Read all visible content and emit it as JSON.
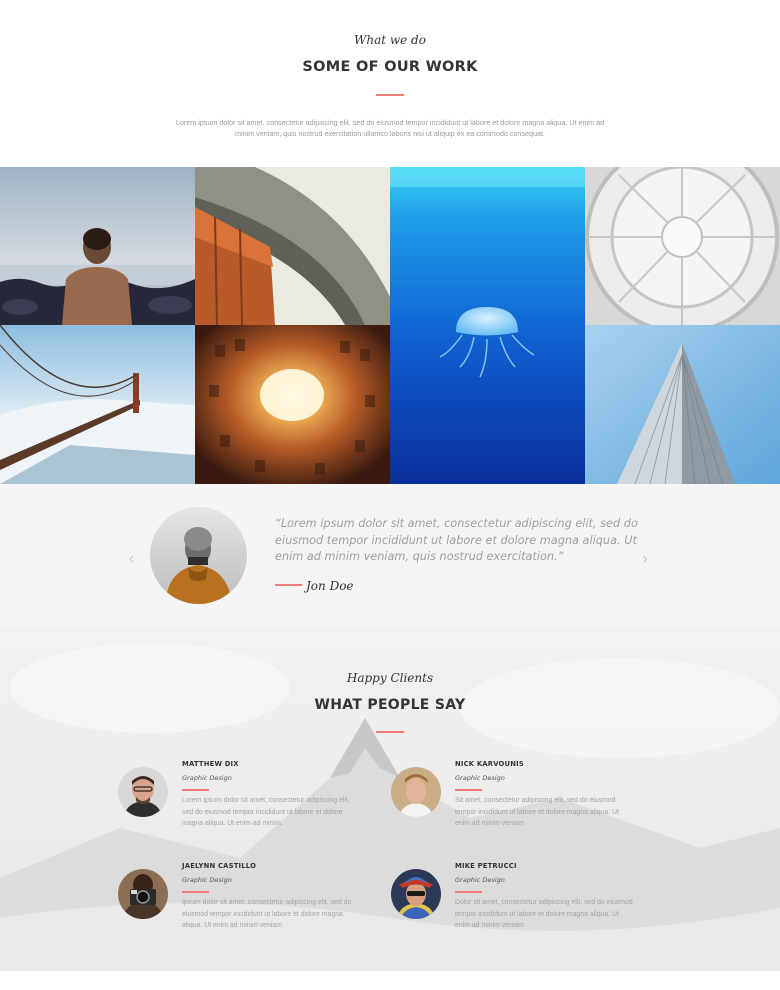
{
  "work": {
    "subtitle": "What we do",
    "title": "SOME OF OUR WORK",
    "description": "Lorem ipsum dolor sit amet, consectetur adipiscing elit, sed do eiusmod tempor incididunt ut labore et dolore magna aliqua. Ut enim ad minim veniam, quis nostrud exercitation ullamco laboris nisi ut aliquip ex ea commodo consequat."
  },
  "gallery": {
    "items": [
      {
        "name": "man-on-beach"
      },
      {
        "name": "bridge-underside"
      },
      {
        "name": "jellyfish"
      },
      {
        "name": "glass-dome"
      },
      {
        "name": "golden-gate-fog"
      },
      {
        "name": "courtyard-looking-up"
      },
      {
        "name": "skyscraper"
      }
    ]
  },
  "testimonial": {
    "quote": "“Lorem ipsum dolor sit amet, consectetur adipiscing elit, sed do eiusmod tempor incididunt ut labore et dolore magna aliqua. Ut enim ad minim veniam, quis nostrud exercitation.”",
    "author": "Jon Doe",
    "prev_icon": "‹",
    "next_icon": "›"
  },
  "clients": {
    "subtitle": "Happy Clients",
    "title": "WHAT PEOPLE SAY",
    "people": [
      {
        "name": "MATTHEW DIX",
        "role": "Graphic Design",
        "text": "Lorem ipsum dolor sit amet, consectetur adipiscing elit, sed do eiusmod tempor incididunt ut labore et dolore magna aliqua. Ut enim ad minim."
      },
      {
        "name": "NICK KARVOUNIS",
        "role": "Graphic Design",
        "text": "Sit amet, consectetur adipiscing elit, sed do eiusmod tempor incididunt ut labore et dolore magna aliqua. Ut enim ad minim veniam"
      },
      {
        "name": "JAELYNN CASTILLO",
        "role": "Graphic Design",
        "text": "Ipsum dolor sit amet, consectetur adipiscing elit, sed do eiusmod tempor incididunt ut labore et dolore magna aliqua. Ut enim ad minim veniam"
      },
      {
        "name": "MIKE PETRUCCI",
        "role": "Graphic Design",
        "text": "Dolor sit amet, consectetur adipiscing elit, sed do eiusmod tempor incididunt ut labore et dolore magna aliqua. Ut enim ad minim veniam"
      }
    ]
  },
  "colors": {
    "accent": "#ef7b7b",
    "muted_text": "#9a9a9a",
    "heading": "#333333",
    "section_bg": "#f5f5f5"
  }
}
